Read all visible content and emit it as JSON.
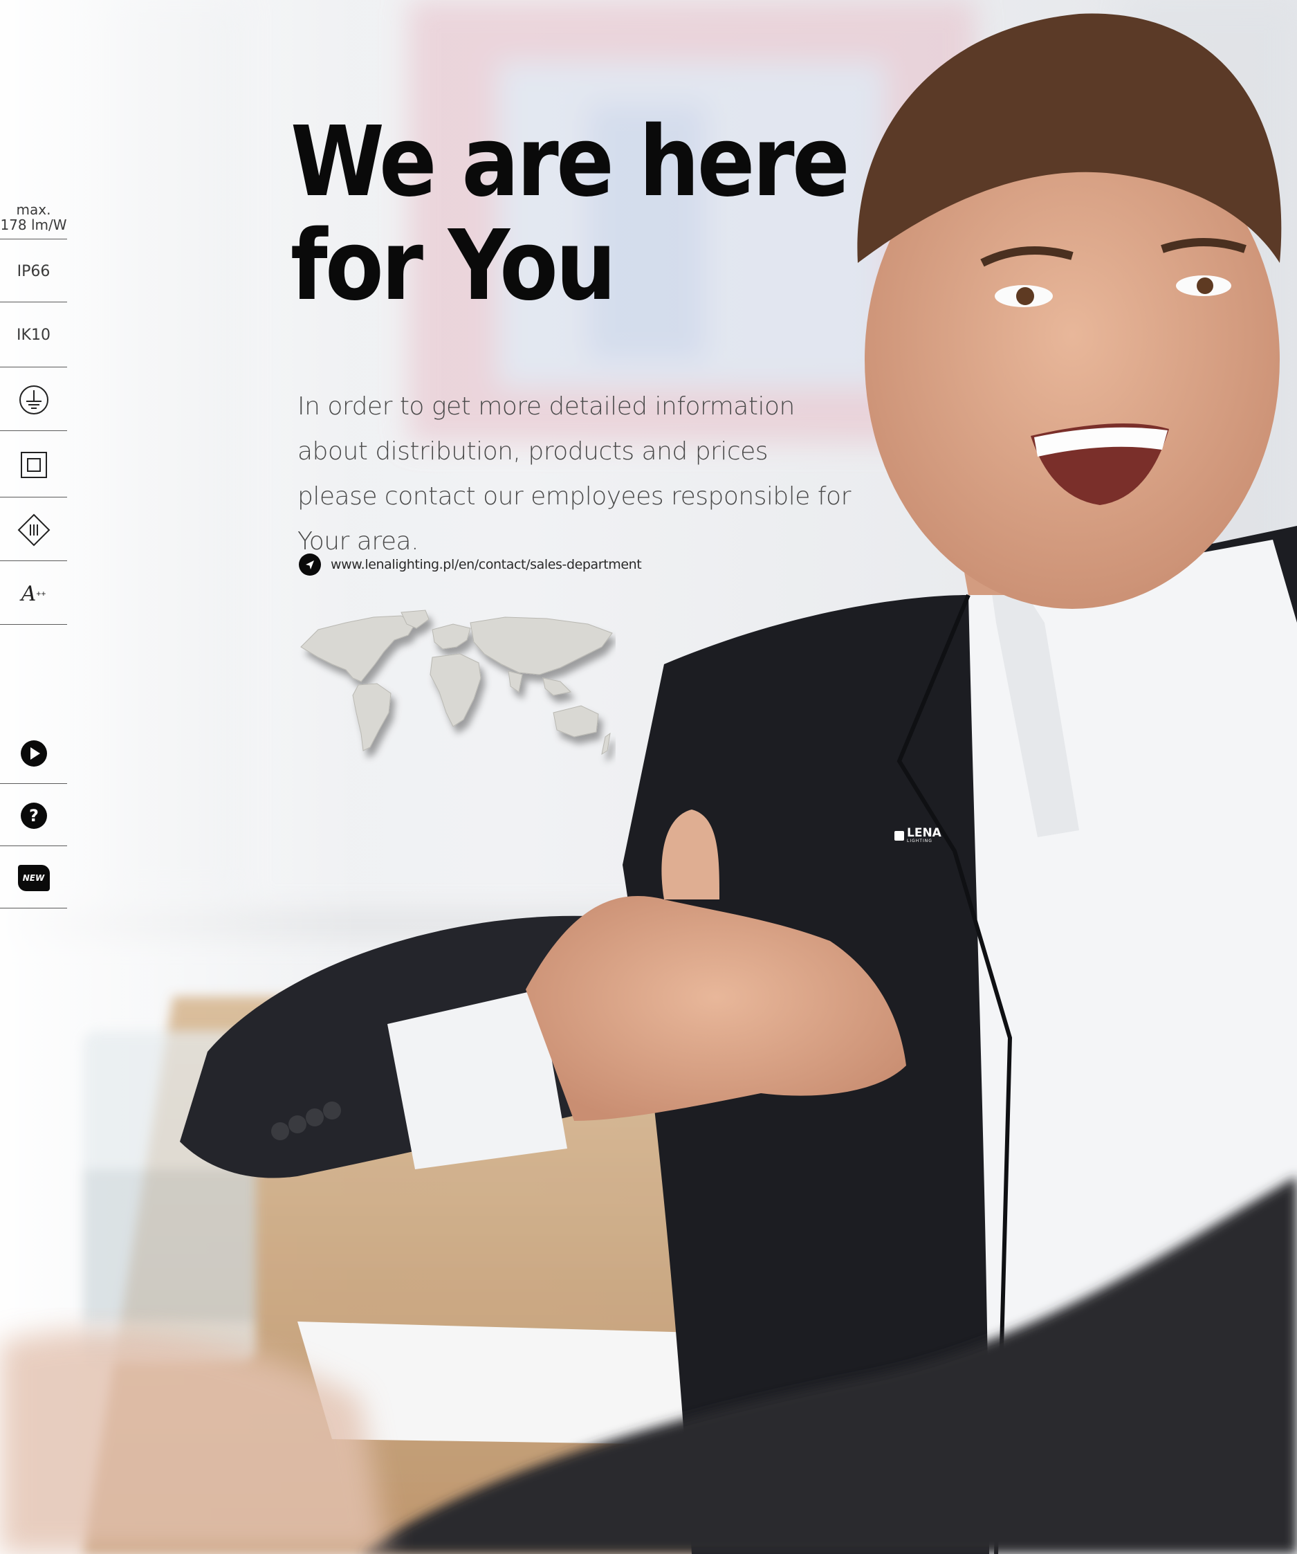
{
  "sidebar": {
    "efficacy": {
      "line1": "max.",
      "line2": "178 lm/W"
    },
    "ip_rating": "IP66",
    "ik_rating": "IK10",
    "icons": [
      "earth-ground-icon",
      "class-ii-insulation-icon",
      "class-iii-icon",
      "energy-class-a-plus-plus-icon"
    ],
    "energy_class": {
      "letter": "A",
      "sup": "++"
    },
    "bottom_icons": [
      "play-icon",
      "question-icon",
      "new-badge-icon"
    ],
    "new_badge": "NEW"
  },
  "content": {
    "title_line1": "We are here",
    "title_line2": "for You",
    "intro": "In order to get more detailed information about distribution, products and prices please contact our employees responsible for Your area.",
    "link": "www.lenalighting.pl/en/contact/sales-department"
  },
  "jacket_logo": {
    "line1": "LENA",
    "line2": "LIGHTING"
  },
  "colors": {
    "jacket": "#1c1d22",
    "shirt": "#f4f5f7",
    "table": "#c9a57e",
    "accent": "#c8475a"
  }
}
